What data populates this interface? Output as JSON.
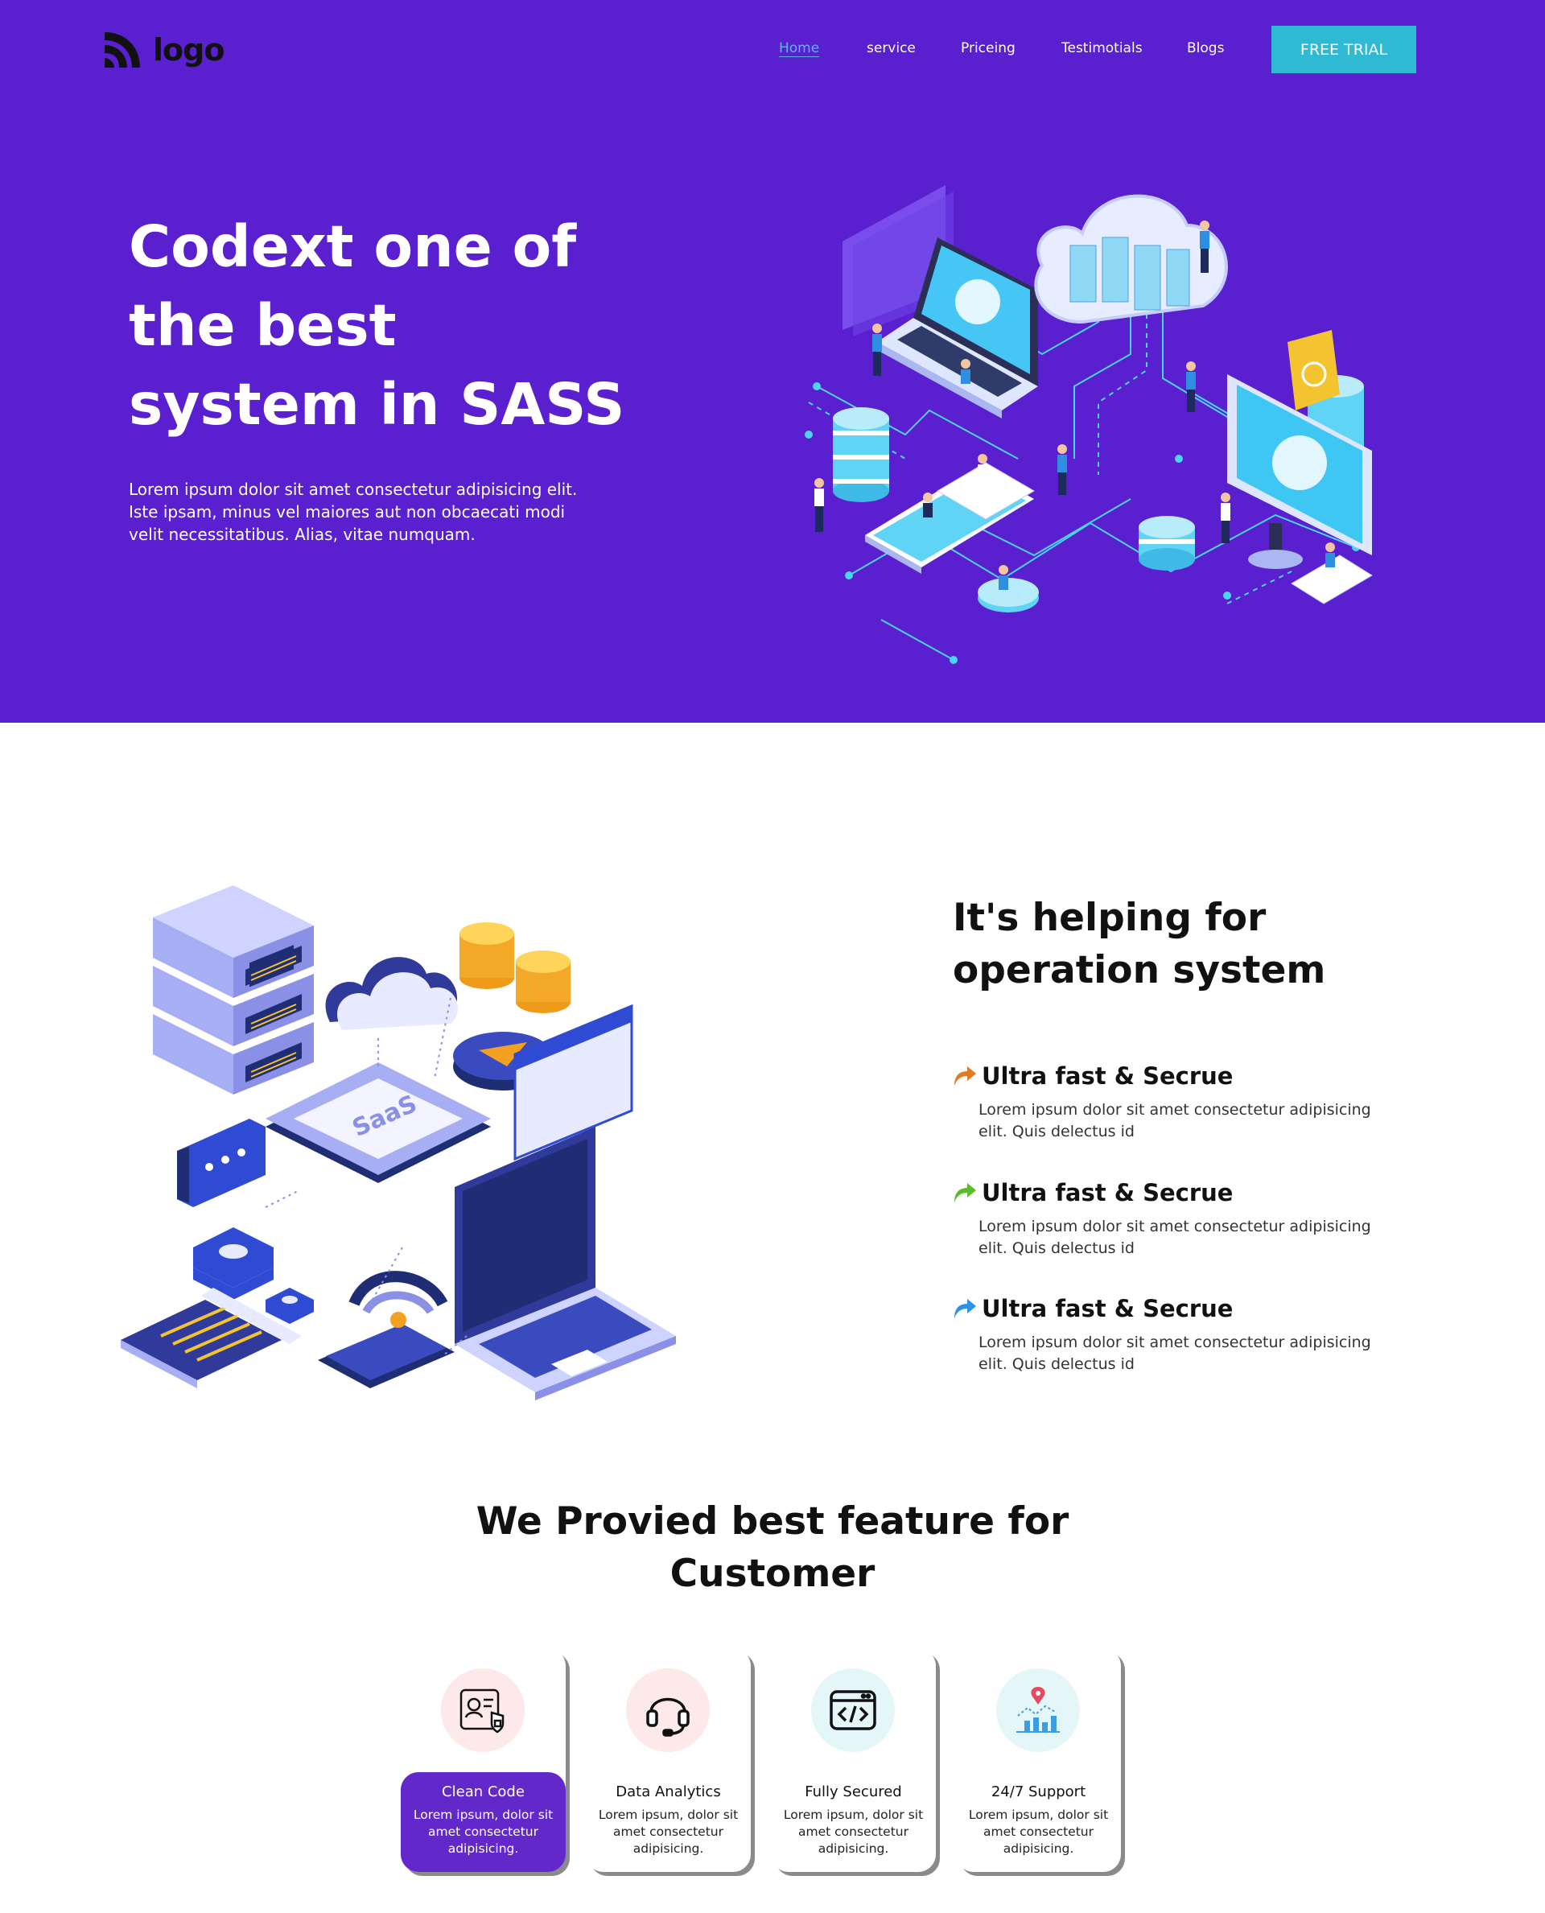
{
  "header": {
    "logo_text": "logo",
    "nav": [
      "Home",
      "service",
      "Priceing",
      "Testimotials",
      "Blogs"
    ],
    "cta_label": "FREE TRIAL"
  },
  "hero": {
    "title": "Codext one of the best system in SASS",
    "subtitle": "Lorem ipsum dolor sit amet consectetur adipisicing elit. Iste ipsam, minus vel maiores aut non obcaecati modi velit necessitatibus. Alias, vitae numquam."
  },
  "helping": {
    "title": "It's helping for operation system",
    "features": [
      {
        "title": "Ultra fast & Secrue",
        "desc": "Lorem ipsum dolor sit amet consectetur adipisicing elit. Quis delectus id",
        "color": "#e07b22"
      },
      {
        "title": "Ultra fast & Secrue",
        "desc": "Lorem ipsum dolor sit amet consectetur adipisicing elit. Quis delectus id",
        "color": "#5cbd2c"
      },
      {
        "title": "Ultra fast & Secrue",
        "desc": "Lorem ipsum dolor sit amet consectetur adipisicing elit. Quis delectus id",
        "color": "#2a93e8"
      }
    ]
  },
  "features_section": {
    "title": "We Provied best feature for Customer",
    "cards": [
      {
        "title": "Clean Code",
        "text": "Lorem ipsum, dolor sit amet consectetur adipisicing.",
        "icon": "document-shield-icon"
      },
      {
        "title": "Data Analytics",
        "text": "Lorem ipsum, dolor sit amet consectetur adipisicing.",
        "icon": "headset-icon"
      },
      {
        "title": "Fully Secured",
        "text": "Lorem ipsum, dolor sit amet consectetur adipisicing.",
        "icon": "code-window-icon"
      },
      {
        "title": "24/7 Support",
        "text": "Lorem ipsum, dolor sit amet consectetur adipisicing.",
        "icon": "analytics-chart-icon"
      }
    ]
  },
  "colors": {
    "hero_bg": "#5a1fcf",
    "cta_bg": "#2fb9d2",
    "active_nav": "#5fb2ff",
    "active_card": "#6328c9"
  }
}
